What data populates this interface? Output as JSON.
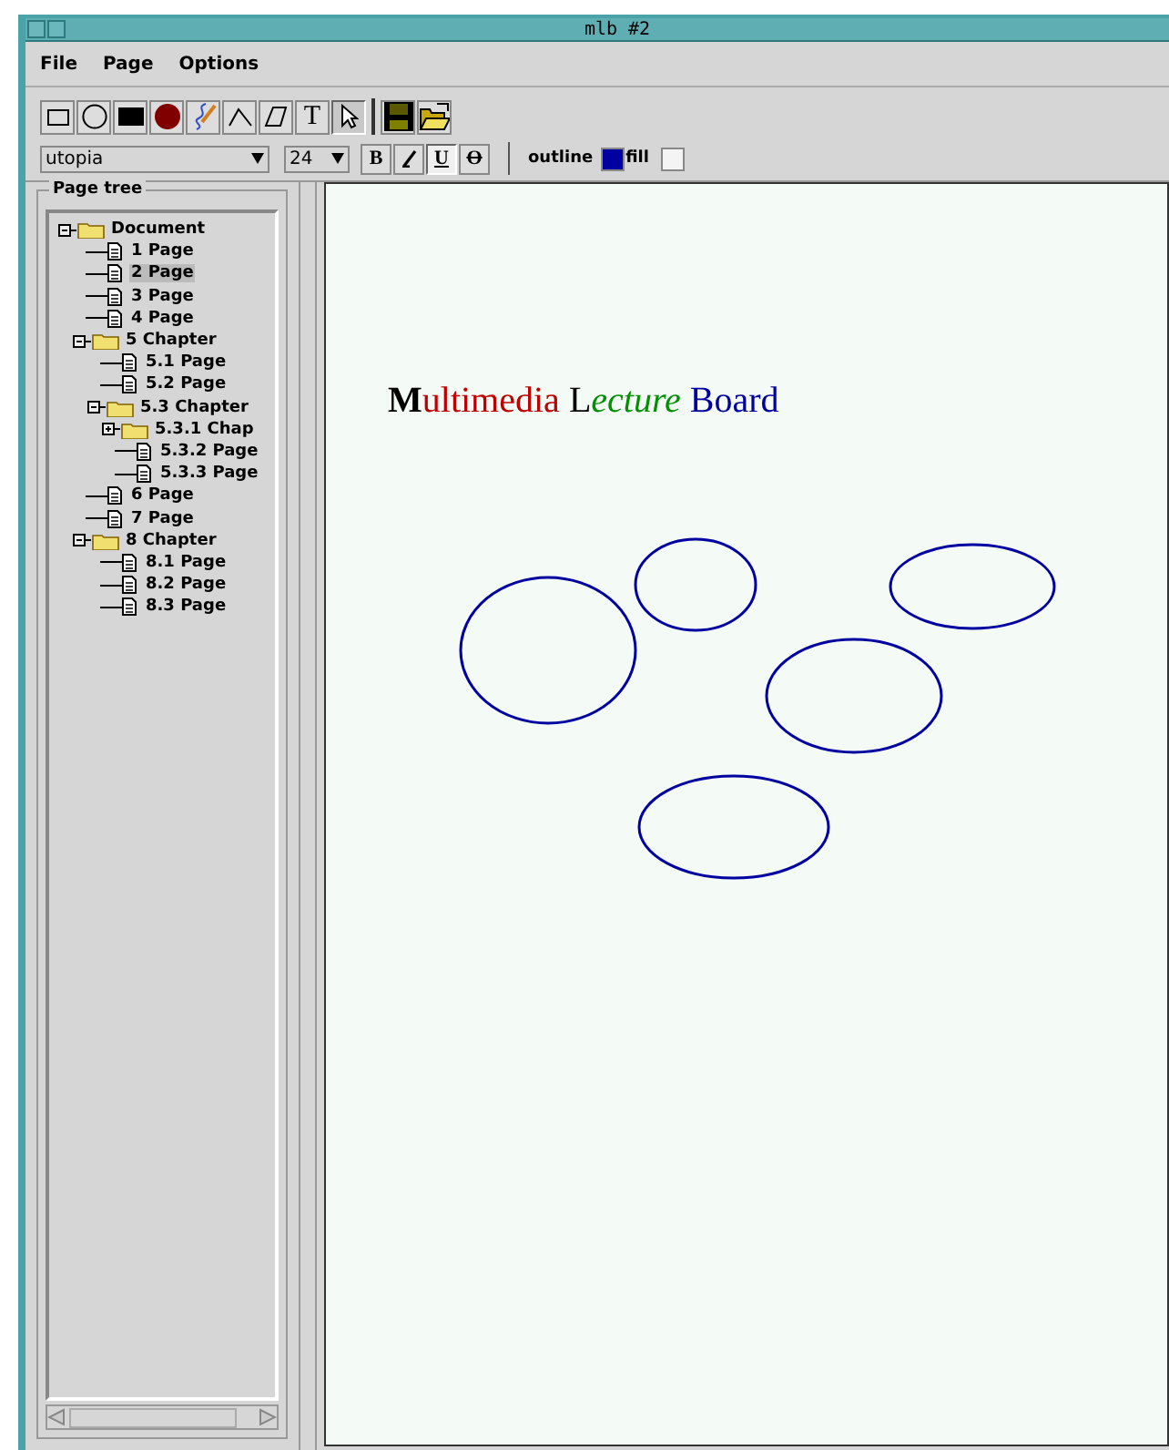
{
  "window": {
    "title": "mlb #2"
  },
  "menu": [
    "File",
    "Page",
    "Options"
  ],
  "tools": [
    {
      "kind": "rect",
      "selected": false
    },
    {
      "kind": "circle",
      "selected": false
    },
    {
      "kind": "filled-rect",
      "selected": false
    },
    {
      "kind": "filled-circle",
      "selected": false
    },
    {
      "kind": "freehand",
      "selected": false
    },
    {
      "kind": "polyline",
      "selected": false
    },
    {
      "kind": "polygon",
      "selected": false
    },
    {
      "kind": "text",
      "label": "T",
      "selected": false
    },
    {
      "kind": "pointer",
      "selected": true
    }
  ],
  "file_tools": [
    {
      "kind": "save"
    },
    {
      "kind": "open"
    }
  ],
  "font": {
    "family": "utopia",
    "size": "24"
  },
  "format_buttons": [
    {
      "kind": "text",
      "label": "B",
      "selected": false
    },
    {
      "kind": "italic",
      "selected": false
    },
    {
      "kind": "text",
      "label": "U",
      "selected": true
    },
    {
      "kind": "text",
      "label": "O",
      "selected": false
    }
  ],
  "outline": {
    "label": "outline",
    "color": "#0000a0"
  },
  "fill": {
    "label": "fill",
    "color": "#f4f4f4"
  },
  "page_tree": {
    "title": "Page tree",
    "items": [
      {
        "label": "Document",
        "kind": "folder",
        "expanded": true,
        "selected": false,
        "children": [
          {
            "label": "1 Page",
            "kind": "page",
            "selected": false
          },
          {
            "label": "2 Page",
            "kind": "page",
            "selected": true
          },
          {
            "label": "3 Page",
            "kind": "page",
            "selected": false
          },
          {
            "label": "4 Page",
            "kind": "page",
            "selected": false
          },
          {
            "label": "5 Chapter",
            "kind": "folder",
            "expanded": true,
            "selected": false,
            "children": [
              {
                "label": "5.1 Page",
                "kind": "page",
                "selected": false
              },
              {
                "label": "5.2 Page",
                "kind": "page",
                "selected": false
              },
              {
                "label": "5.3 Chapter",
                "kind": "folder",
                "expanded": true,
                "selected": false,
                "children": [
                  {
                    "label": "5.3.1 Chap",
                    "kind": "folder",
                    "expanded": false,
                    "selected": false
                  },
                  {
                    "label": "5.3.2 Page",
                    "kind": "page",
                    "selected": false
                  },
                  {
                    "label": "5.3.3 Page",
                    "kind": "page",
                    "selected": false
                  }
                ]
              }
            ]
          },
          {
            "label": "6 Page",
            "kind": "page",
            "selected": false
          },
          {
            "label": "7 Page",
            "kind": "page",
            "selected": false
          },
          {
            "label": "8 Chapter",
            "kind": "folder",
            "expanded": true,
            "selected": false,
            "children": [
              {
                "label": "8.1 Page",
                "kind": "page",
                "selected": false
              },
              {
                "label": "8.2 Page",
                "kind": "page",
                "selected": false
              },
              {
                "label": "8.3 Page",
                "kind": "page",
                "selected": false
              }
            ]
          }
        ]
      }
    ]
  },
  "canvas": {
    "heading_words": [
      {
        "parts": [
          {
            "text": "M",
            "color": "#000000",
            "bold": true,
            "italic": false
          },
          {
            "text": "ultimedia",
            "color": "#c00000",
            "bold": false,
            "italic": false
          }
        ]
      },
      {
        "parts": [
          {
            "text": "L",
            "color": "#000000",
            "bold": false,
            "italic": false
          },
          {
            "text": "ecture",
            "color": "#009000",
            "bold": false,
            "italic": true
          }
        ]
      },
      {
        "parts": [
          {
            "text": "Board",
            "color": "#0000a0",
            "bold": false,
            "italic": false
          }
        ]
      }
    ],
    "shapes": [
      {
        "kind": "ellipse",
        "color": "#0000a0"
      },
      {
        "kind": "ellipse",
        "color": "#0000a0"
      },
      {
        "kind": "ellipse",
        "color": "#0000a0"
      },
      {
        "kind": "ellipse",
        "color": "#0000a0"
      },
      {
        "kind": "ellipse",
        "color": "#0000a0"
      }
    ]
  }
}
